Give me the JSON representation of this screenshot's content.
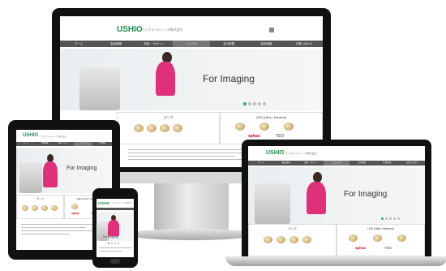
{
  "site": {
    "logo": "USHIO",
    "tagline": "ウシオライティング株式会社",
    "nav": [
      "ホーム",
      "製品情報",
      "技術・サポート",
      "ニュース",
      "会社概要",
      "採用情報",
      "お問い合わせ"
    ],
    "hero_text": "For Imaging",
    "products": [
      {
        "title": "ランプ"
      },
      {
        "title": "LED (Ultra / Infrared)"
      }
    ],
    "brands": {
      "sphax": "sphax",
      "teo": "TEO"
    }
  },
  "colors": {
    "logo": "#1a8f4c",
    "nav": "#555555",
    "dress": "#e0307a",
    "dot_active": "#26a3b3"
  },
  "devices": [
    "monitor",
    "laptop",
    "tablet",
    "phone"
  ]
}
